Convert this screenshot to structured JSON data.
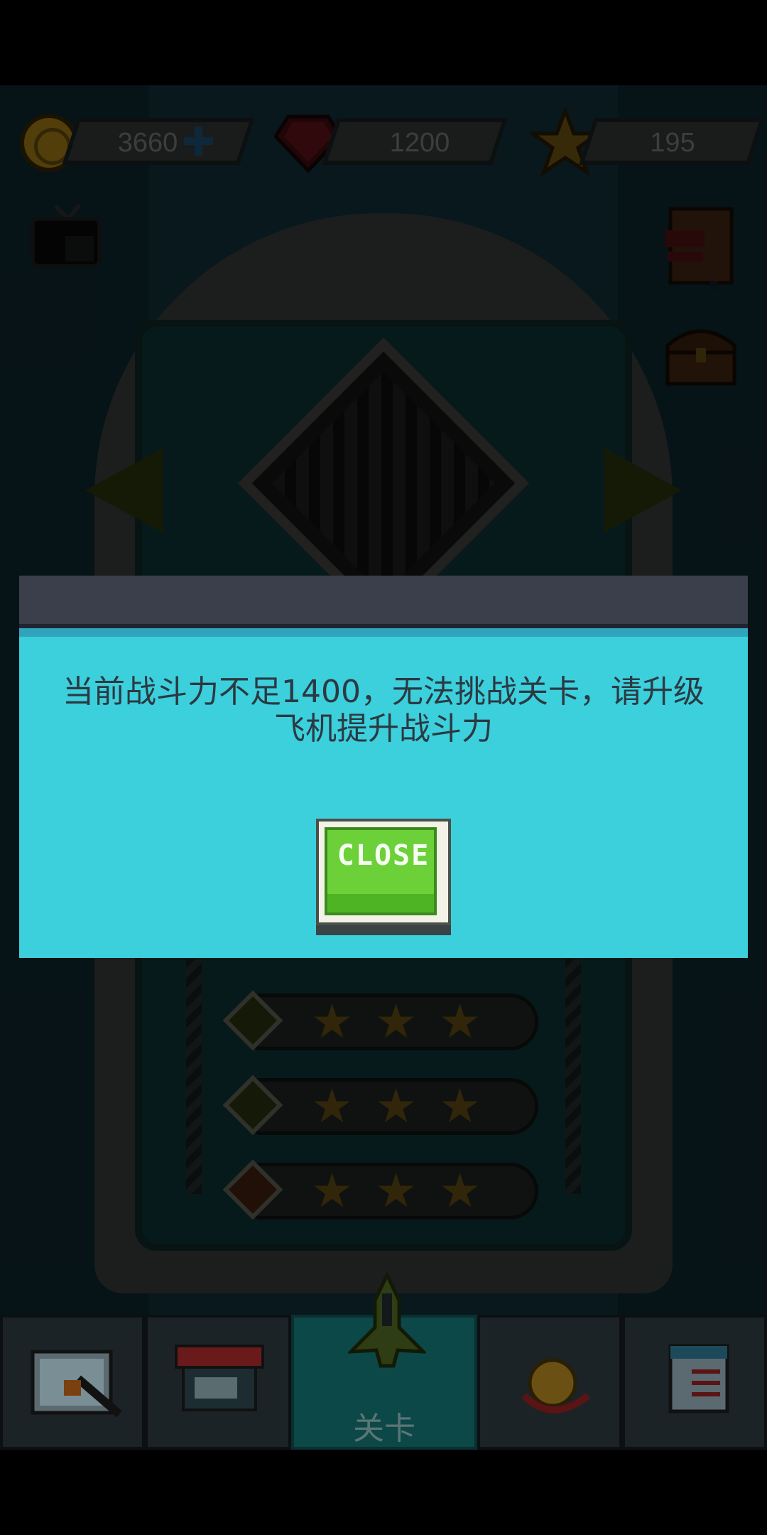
{
  "currencies": {
    "coins": "3660",
    "gems": "1200",
    "stars": "195"
  },
  "icons": {
    "coin": "coin-icon",
    "coin_add": "plus-icon",
    "gem": "ruby-icon",
    "star": "star-icon",
    "tv": "tv-icon",
    "book": "book-icon",
    "chest": "treasure-chest-icon",
    "prev": "arrow-left-icon",
    "next": "arrow-right-icon"
  },
  "levels": [
    {
      "gem_color": "#2f3a12",
      "stars": [
        "★",
        "★",
        "★"
      ]
    },
    {
      "gem_color": "#2f3a12",
      "stars": [
        "★",
        "★",
        "★"
      ]
    },
    {
      "gem_color": "#4a2410",
      "stars": [
        "★",
        "★",
        "★"
      ]
    }
  ],
  "dialog": {
    "message": "当前战斗力不足1400，无法挑战关卡，请升级飞机提升战斗力",
    "close_label": "CLOSE"
  },
  "nav": {
    "tabs": [
      {
        "name": "hangar",
        "label": ""
      },
      {
        "name": "shop",
        "label": ""
      },
      {
        "name": "levels",
        "label": "关卡"
      },
      {
        "name": "rewards",
        "label": ""
      },
      {
        "name": "tasks",
        "label": ""
      }
    ]
  },
  "colors": {
    "dialog_bg": "#3ccfdc",
    "close_green": "#6cd038"
  }
}
